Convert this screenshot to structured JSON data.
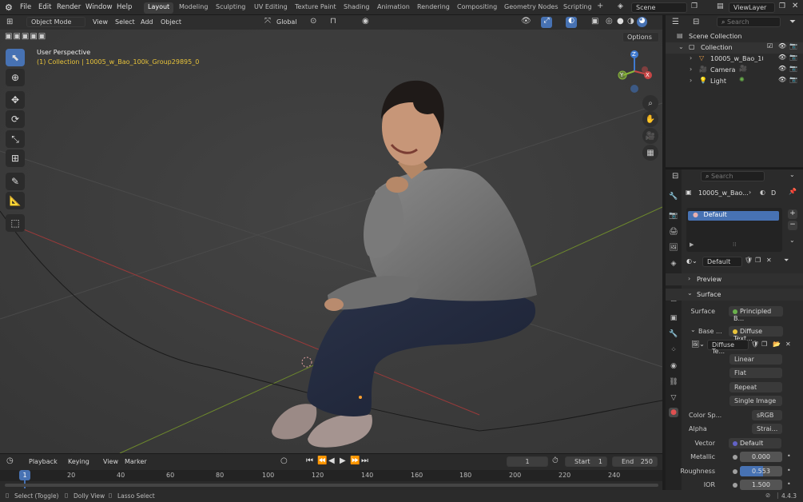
{
  "menu": [
    "File",
    "Edit",
    "Render",
    "Window",
    "Help"
  ],
  "workspaces": [
    "Layout",
    "Modeling",
    "Sculpting",
    "UV Editing",
    "Texture Paint",
    "Shading",
    "Animation",
    "Rendering",
    "Compositing",
    "Geometry Nodes",
    "Scripting"
  ],
  "active_workspace": "Layout",
  "plus_tab": "+",
  "scene": "Scene",
  "view_layer": "ViewLayer",
  "viewport": {
    "mode": "Object Mode",
    "menus": [
      "View",
      "Select",
      "Add",
      "Object"
    ],
    "transform": "Global",
    "options": "Options",
    "perspective": "User Perspective",
    "collection_info": "(1) Collection | 10005_w_Bao_100k_Group29895_0",
    "gizmo_axes": [
      "Z",
      "X",
      "Y"
    ]
  },
  "outliner": {
    "search_placeholder": "Search",
    "root": "Scene Collection",
    "collection": "Collection",
    "items": [
      "10005_w_Bao_10(",
      "Camera",
      "Light"
    ]
  },
  "properties": {
    "search_placeholder": "Search",
    "object": "10005_w_Bao...",
    "data_letter": "D",
    "material_slot": "Default",
    "material_name": "Default",
    "sections": {
      "preview": "Preview",
      "surface": "Surface"
    },
    "surface_shader": "Principled B...",
    "base_label": "Base ...",
    "base_value": "Diffuse Text...",
    "image_name": "Diffuse Te...",
    "dropdowns": [
      "Linear",
      "Flat",
      "Repeat",
      "Single Image"
    ],
    "color_space_label": "Color Sp...",
    "color_space": "sRGB",
    "alpha_label": "Alpha",
    "alpha": "Strai...",
    "vector_label": "Vector",
    "vector": "Default",
    "metallic_label": "Metallic",
    "metallic": "0.000",
    "roughness_label": "Roughness",
    "roughness": "0.553",
    "roughness_fraction": 0.553,
    "ior_label": "IOR",
    "ior": "1.500"
  },
  "timeline": {
    "menus": [
      "Playback",
      "Keying",
      "View",
      "Marker"
    ],
    "current_frame": "1",
    "start_label": "Start",
    "start": "1",
    "end_label": "End",
    "end": "250",
    "ruler": [
      "20",
      "40",
      "60",
      "80",
      "100",
      "120",
      "140",
      "160",
      "180",
      "200",
      "220",
      "240"
    ],
    "ruler_current": "1"
  },
  "status": {
    "select": "Select (Toggle)",
    "dolly": "Dolly View",
    "lasso": "Lasso Select",
    "version": "4.4.3"
  },
  "colors": {
    "accent": "#4772b3",
    "collection_info": "#e8c33a",
    "x_axis": "#c84646",
    "y_axis": "#8ab83a",
    "z_axis": "#3f7ad0"
  }
}
